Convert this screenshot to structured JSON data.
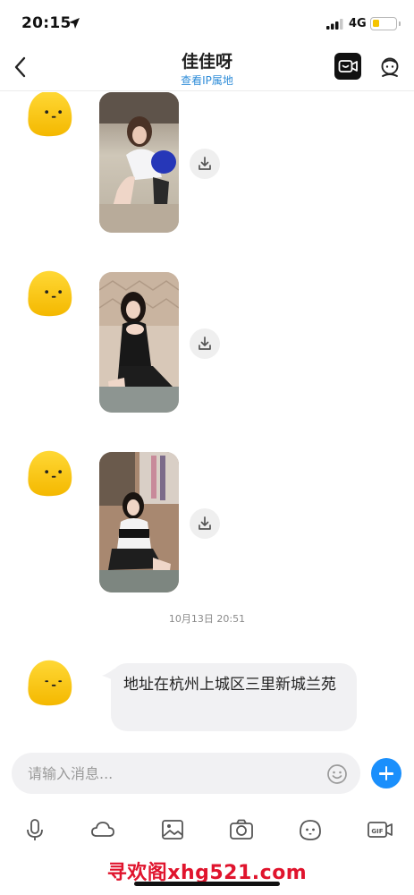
{
  "status_bar": {
    "time": "20:15",
    "network": "4G",
    "battery_level": 0.3,
    "battery_color": "#f5c400"
  },
  "header": {
    "back_icon": "chevron-left-icon",
    "contact_name": "佳佳呀",
    "ip_link": "查看IP属地",
    "video_call_icon": "video-call-icon",
    "profile_icon": "profile-icon"
  },
  "chat": {
    "messages": [
      {
        "type": "image",
        "avatar": "yellow-blob-avatar",
        "image": "photo-woman-kneeling-white-blue-outfit",
        "action_icon": "download-icon"
      },
      {
        "type": "image",
        "avatar": "yellow-blob-avatar",
        "image": "photo-woman-black-dress-kneeling",
        "action_icon": "download-icon"
      },
      {
        "type": "image",
        "avatar": "yellow-blob-avatar",
        "image": "photo-woman-black-white-outfit-kneeling",
        "action_icon": "download-icon"
      }
    ],
    "timestamp": "10月13日  20:51",
    "text_message": {
      "avatar": "yellow-blob-avatar",
      "text": "地址在杭州上城区三里新城兰苑"
    }
  },
  "input_bar": {
    "placeholder": "请输入消息...",
    "emoji_icon": "smiley-icon",
    "send_more_icon": "plus-icon",
    "accent_color": "#1a8ffc"
  },
  "toolbar": {
    "items": [
      "microphone-icon",
      "cloud-icon",
      "image-icon",
      "camera-icon",
      "emoji-face-icon",
      "gif-icon"
    ]
  },
  "watermark": "寻欢阁xhg521.com"
}
